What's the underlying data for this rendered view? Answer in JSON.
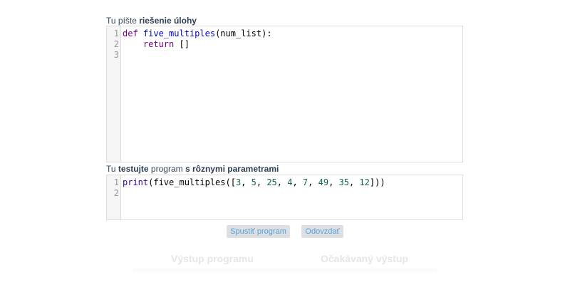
{
  "editor1": {
    "label_prefix": "Tu píšte ",
    "label_bold": "riešenie úlohy",
    "line_numbers": [
      "1",
      "2",
      "3"
    ],
    "line1": {
      "def": "def",
      "fname": "five_multiples",
      "rest": "(num_list):"
    },
    "line2": {
      "indent": "    ",
      "kw": "return",
      "rest": " []"
    }
  },
  "editor2": {
    "label_prefix": "Tu ",
    "label_bold1": "testujte",
    "label_mid": " program ",
    "label_bold2": "s rôznymi parametrami",
    "line_numbers": [
      "1",
      "2"
    ],
    "line1": {
      "print": "print",
      "p1": "(five_multiples([",
      "n1": "3",
      "s1": ", ",
      "n2": "5",
      "s2": ", ",
      "n3": "25",
      "s3": ", ",
      "n4": "4",
      "s4": ", ",
      "n5": "7",
      "s5": ", ",
      "n6": "49",
      "s6": ", ",
      "n7": "35",
      "s7": ", ",
      "n8": "12",
      "p2": "]))"
    }
  },
  "buttons": {
    "run": "Spustiť program",
    "submit": "Odovzdať"
  },
  "output": {
    "program_output": "Výstup programu",
    "expected_output": "Očakávaný výstup"
  }
}
